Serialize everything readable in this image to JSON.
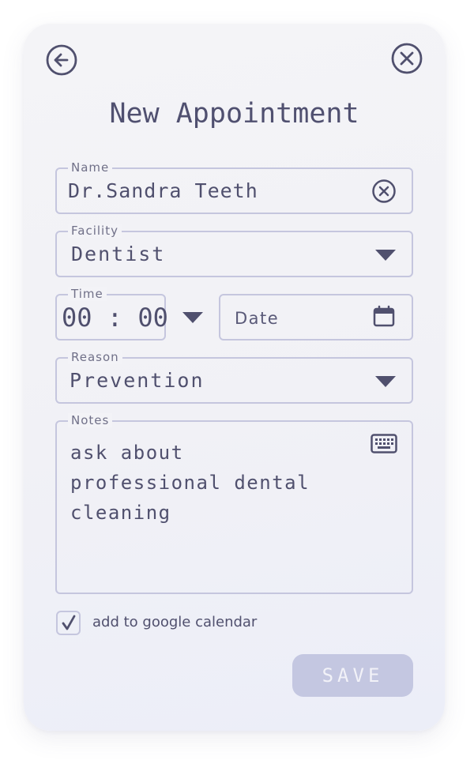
{
  "header": {
    "title": "New Appointment",
    "back_icon": "arrow-left-circle-icon",
    "close_icon": "close-circle-icon"
  },
  "form": {
    "name": {
      "label": "Name",
      "value": "Dr.Sandra Teeth",
      "clear_icon": "clear-circle-icon"
    },
    "facility": {
      "label": "Facility",
      "value": "Dentist",
      "icon": "dropdown-caret-icon"
    },
    "time": {
      "label": "Time",
      "value": "00 : 00",
      "icon": "dropdown-caret-icon"
    },
    "date": {
      "placeholder": "Date",
      "icon": "calendar-icon"
    },
    "reason": {
      "label": "Reason",
      "value": "Prevention",
      "icon": "dropdown-caret-icon"
    },
    "notes": {
      "label": "Notes",
      "value": "ask about\nprofessional dental\ncleaning",
      "icon": "keyboard-icon"
    },
    "calendar_checkbox": {
      "label": "add to google calendar",
      "checked": true
    }
  },
  "actions": {
    "save_label": "SAVE"
  },
  "colors": {
    "text": "#50506e",
    "border": "#c5c6de",
    "save_button": "#c4c7e1",
    "card_background": "#f3f3f7"
  }
}
